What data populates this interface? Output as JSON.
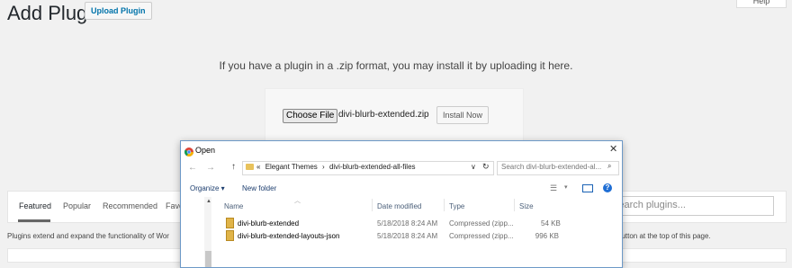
{
  "header": {
    "title": "Add Plugins",
    "upload_button": "Upload Plugin",
    "help_tab": "Help"
  },
  "upload": {
    "description": "If you have a plugin in a .zip format, you may install it by uploading it here.",
    "choose_file_label": "Choose File",
    "file_name": "divi-blurb-extended.zip",
    "install_button": "Install Now"
  },
  "filters": {
    "items": [
      "Featured",
      "Popular",
      "Recommended",
      "Favo"
    ],
    "active": "Featured",
    "search_placeholder": "Search plugins..."
  },
  "plugins_description_start": "Plugins extend and expand the functionality of Wor",
  "plugins_description_end": "button at the top of this page.",
  "dialog": {
    "title": "Open",
    "close": "✕",
    "nav": {
      "back": "←",
      "forward": "→",
      "up": "↑"
    },
    "address": {
      "path_prefix": "«",
      "crumb1": "Elegant Themes",
      "separator": "›",
      "crumb2": "divi-blurb-extended-all-files"
    },
    "search_placeholder": "Search divi-blurb-extended-al...",
    "toolbar": {
      "organize": "Organize ▾",
      "new_folder": "New folder"
    },
    "columns": {
      "name": "Name",
      "date": "Date modified",
      "type": "Type",
      "size": "Size"
    },
    "files": [
      {
        "name": "divi-blurb-extended",
        "date": "5/18/2018 8:24 AM",
        "type": "Compressed (zipp...",
        "size": "54 KB"
      },
      {
        "name": "divi-blurb-extended-layouts-json",
        "date": "5/18/2018 8:24 AM",
        "type": "Compressed (zipp...",
        "size": "996 KB"
      }
    ]
  },
  "colors": {
    "accent": "#0073aa",
    "dialog_border": "#6d99c7",
    "folder": "#e8c25c"
  }
}
